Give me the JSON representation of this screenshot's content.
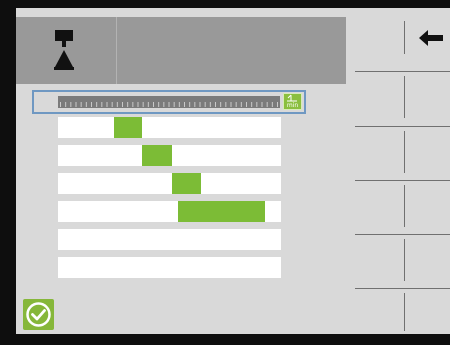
{
  "header": {
    "icon": "tool-position-icon"
  },
  "softkeys": {
    "back_icon": "arrow-left-icon"
  },
  "timeline": {
    "unit_label": "min",
    "unit_icon": "time-unit-icon",
    "tick_count": 42
  },
  "schedule": {
    "rows": [
      {
        "start": 0.25,
        "end": 0.375
      },
      {
        "start": 0.375,
        "end": 0.51
      },
      {
        "start": 0.51,
        "end": 0.64
      },
      {
        "start": 0.54,
        "end": 0.93
      },
      null,
      null
    ]
  },
  "footer": {
    "confirm_icon": "checkmark-circle-icon"
  },
  "colors": {
    "accent_green": "#7cbc36",
    "header_gray": "#999999",
    "selection_blue": "#6f98c2",
    "background": "#d9d9d9"
  }
}
